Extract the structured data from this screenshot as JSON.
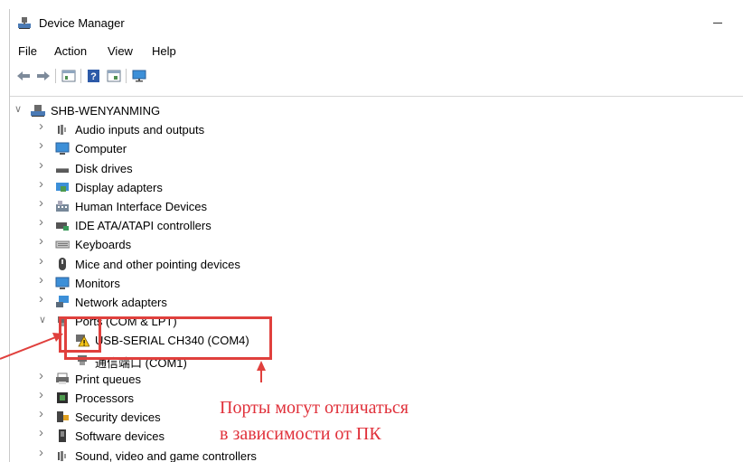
{
  "window": {
    "title": "Device Manager"
  },
  "menu": [
    "File",
    "Action",
    "View",
    "Help"
  ],
  "toolbar": [
    "back-icon",
    "forward-icon",
    "properties-icon",
    "help-icon",
    "view-icon",
    "monitor-icon"
  ],
  "tree": {
    "root": "SHB-WENYANMING",
    "items": [
      {
        "label": "Audio inputs and outputs",
        "icon": "speaker-icon",
        "expanded": false
      },
      {
        "label": "Computer",
        "icon": "computer-icon",
        "expanded": false
      },
      {
        "label": "Disk drives",
        "icon": "disk-drive-icon",
        "expanded": false
      },
      {
        "label": "Display adapters",
        "icon": "display-adapter-icon",
        "expanded": false
      },
      {
        "label": "Human Interface Devices",
        "icon": "hid-icon",
        "expanded": false
      },
      {
        "label": "IDE ATA/ATAPI controllers",
        "icon": "ide-controller-icon",
        "expanded": false
      },
      {
        "label": "Keyboards",
        "icon": "keyboard-icon",
        "expanded": false
      },
      {
        "label": "Mice and other pointing devices",
        "icon": "mouse-icon",
        "expanded": false
      },
      {
        "label": "Monitors",
        "icon": "monitor-icon",
        "expanded": false
      },
      {
        "label": "Network adapters",
        "icon": "network-adapter-icon",
        "expanded": false
      },
      {
        "label": "Ports (COM & LPT)",
        "icon": "port-icon",
        "expanded": true
      },
      {
        "label": "USB-SERIAL CH340 (COM4)",
        "icon": "warning-port-icon",
        "child": true
      },
      {
        "label": "通信端口 (COM1)",
        "icon": "port-icon",
        "child": true
      },
      {
        "label": "Print queues",
        "icon": "printer-icon",
        "expanded": false
      },
      {
        "label": "Processors",
        "icon": "processor-icon",
        "expanded": false
      },
      {
        "label": "Security devices",
        "icon": "security-device-icon",
        "expanded": false
      },
      {
        "label": "Software devices",
        "icon": "software-device-icon",
        "expanded": false
      },
      {
        "label": "Sound, video and game controllers",
        "icon": "sound-icon",
        "expanded": false
      }
    ]
  },
  "annotation": {
    "line1": "Порты могут отличаться",
    "line2": "в зависимости от ПК",
    "color": "#e0303a"
  }
}
